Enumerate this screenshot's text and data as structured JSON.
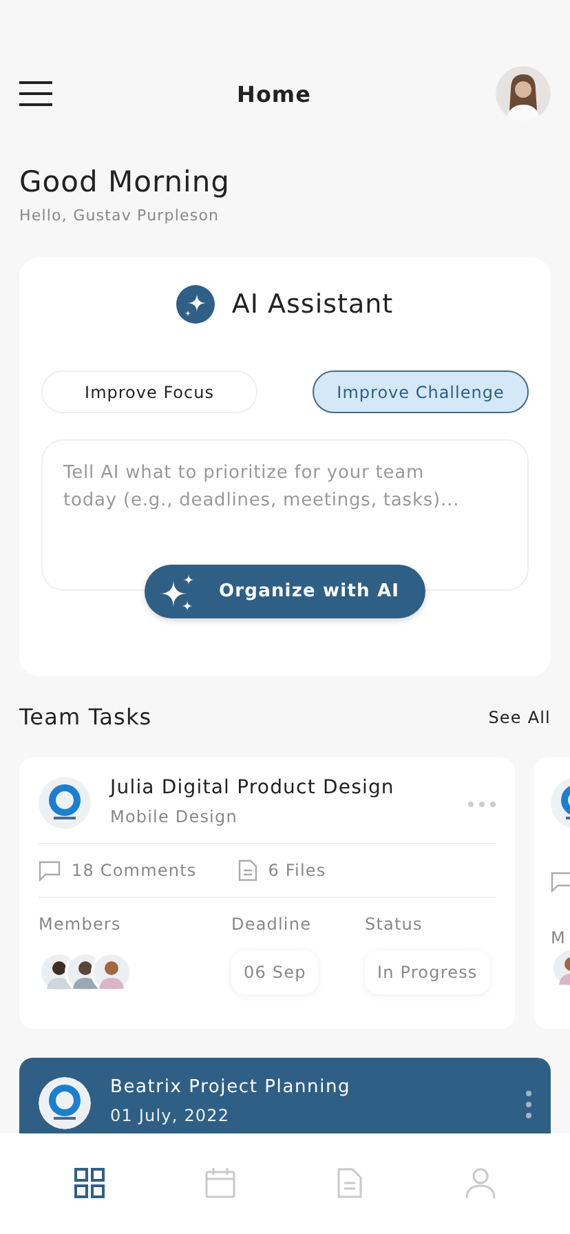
{
  "header": {
    "title": "Home"
  },
  "greeting": {
    "title": "Good Morning",
    "subtitle": "Hello, Gustav Purpleson"
  },
  "assistant": {
    "title": "AI Assistant",
    "chips": [
      {
        "label": "Improve Focus",
        "selected": false
      },
      {
        "label": "Improve Challenge",
        "selected": true
      }
    ],
    "prompt": {
      "placeholder": "Tell AI what to prioritize for your team today (e.g., deadlines, meetings, tasks)..."
    },
    "button": "Organize with AI"
  },
  "team_tasks": {
    "title": "Team Tasks",
    "link": "See All",
    "tasks": [
      {
        "title": "Julia Digital Product Design",
        "subtitle": "Mobile Design",
        "comments": "18 Comments",
        "files": "6 Files",
        "members_label": "Members",
        "deadline_label": "Deadline",
        "deadline": "06 Sep",
        "status_label": "Status",
        "status": "In Progress",
        "members": [
          {
            "kind": "avatar"
          },
          {
            "kind": "avatar"
          },
          {
            "kind": "avatar"
          }
        ]
      }
    ],
    "peek": {
      "label": "M"
    }
  },
  "projects": [
    {
      "title": "Beatrix Project Planning",
      "date": "01 July, 2022"
    }
  ],
  "nav": [
    {
      "kind": "grid",
      "selected": true
    },
    {
      "kind": "calendar",
      "selected": false
    },
    {
      "kind": "document",
      "selected": false
    },
    {
      "kind": "person",
      "selected": false
    }
  ]
}
